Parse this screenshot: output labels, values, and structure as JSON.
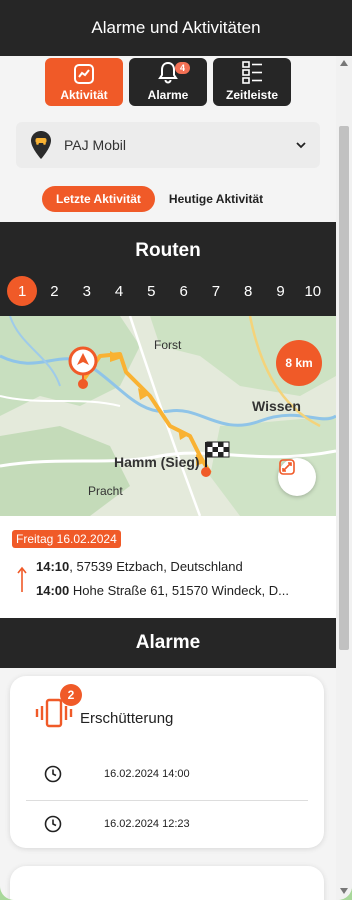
{
  "header": {
    "title": "Alarme und Aktivitäten"
  },
  "tabs": [
    {
      "label": "Aktivität",
      "active": true
    },
    {
      "label": "Alarme",
      "badge": "4"
    },
    {
      "label": "Zeitleiste"
    }
  ],
  "device": {
    "name": "PAJ Mobil"
  },
  "segment": {
    "active": "Letzte Aktivität",
    "other": "Heutige Aktivität"
  },
  "routes": {
    "title": "Routen",
    "numbers": [
      "1",
      "2",
      "3",
      "4",
      "5",
      "6",
      "7",
      "8",
      "9",
      "10"
    ],
    "active_index": 0
  },
  "map": {
    "labels": {
      "forst": "Forst",
      "wissen": "Wissen",
      "hamm": "Hamm (Sieg)",
      "pracht": "Pracht"
    },
    "distance": "8 km",
    "colors": {
      "route": "#f9b233",
      "accent": "#f05a28"
    }
  },
  "trip": {
    "date": "Freitag 16.02.2024",
    "end_time": "14:10",
    "end_address": ", 57539 Etzbach, Deutschland",
    "start_time": "14:00",
    "start_address": "Hohe Straße 61, 51570 Windeck, D..."
  },
  "alarms": {
    "title": "Alarme",
    "card": {
      "name": "Erschütterung",
      "count": "2",
      "entries": [
        "16.02.2024 14:00",
        "16.02.2024 12:23"
      ]
    }
  }
}
